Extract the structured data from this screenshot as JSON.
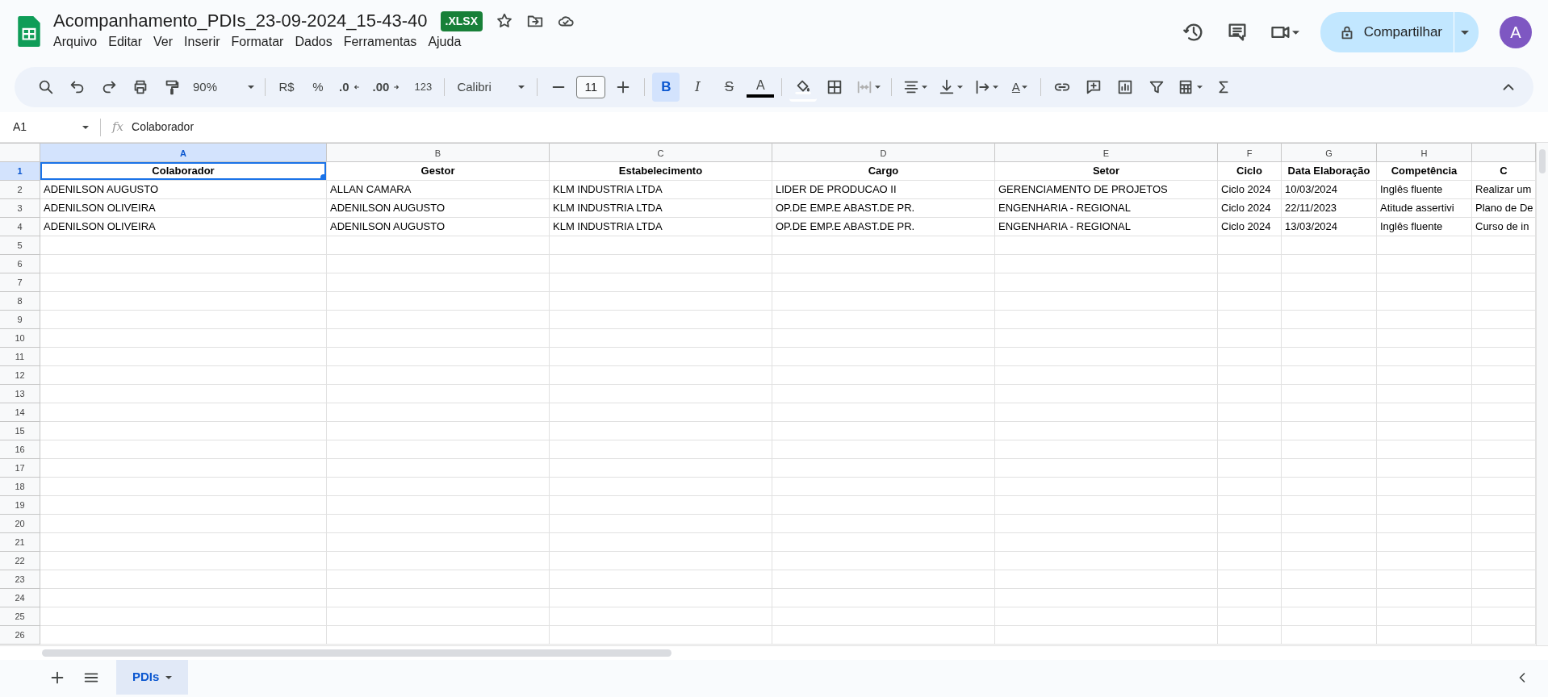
{
  "document": {
    "title": "Acompanhamento_PDIs_23-09-2024_15-43-40",
    "badge": ".XLSX"
  },
  "menu": [
    "Arquivo",
    "Editar",
    "Ver",
    "Inserir",
    "Formatar",
    "Dados",
    "Ferramentas",
    "Ajuda"
  ],
  "share_button": {
    "label": "Compartilhar"
  },
  "avatar": {
    "initial": "A"
  },
  "toolbar": {
    "zoom": "90%",
    "currency": "R$",
    "percent": "%",
    "decrease_decimal": ".0",
    "increase_decimal": ".00",
    "number_format": "123",
    "font": "Calibri",
    "font_size": "11",
    "bold": {
      "label": "B",
      "on": true
    },
    "italic": "I",
    "strikethrough": "S",
    "text_color": "A",
    "text_rotation": "A"
  },
  "formula_bar": {
    "cell": "A1",
    "fx": "fx",
    "value": "Colaborador"
  },
  "sheet": {
    "columns": [
      {
        "letter": "A",
        "selected": true
      },
      {
        "letter": "B",
        "selected": false
      },
      {
        "letter": "C",
        "selected": false
      },
      {
        "letter": "D",
        "selected": false
      },
      {
        "letter": "E",
        "selected": false
      },
      {
        "letter": "F",
        "selected": false
      },
      {
        "letter": "G",
        "selected": false
      },
      {
        "letter": "H",
        "selected": false
      },
      {
        "selected": false
      }
    ],
    "rows": [
      {
        "number": "1",
        "selected": true,
        "kind": "header",
        "cells": [
          "Colaborador",
          "Gestor",
          "Estabelecimento",
          "Cargo",
          "Setor",
          "Ciclo",
          "Data Elaboração",
          "Competência",
          "C"
        ]
      },
      {
        "number": "2",
        "selected": false,
        "kind": "data",
        "cells": [
          "ADENILSON AUGUSTO",
          "ALLAN CAMARA",
          "KLM INDUSTRIA LTDA",
          "LIDER DE PRODUCAO II",
          "GERENCIAMENTO DE PROJETOS",
          "Ciclo 2024",
          "10/03/2024",
          "Inglês fluente",
          "Realizar um"
        ]
      },
      {
        "number": "3",
        "selected": false,
        "kind": "data",
        "cells": [
          "ADENILSON OLIVEIRA",
          "ADENILSON AUGUSTO",
          "KLM INDUSTRIA LTDA",
          "OP.DE EMP.E ABAST.DE PR.",
          "ENGENHARIA - REGIONAL",
          "Ciclo 2024",
          "22/11/2023",
          "Atitude assertivi",
          "Plano de De"
        ]
      },
      {
        "number": "4",
        "selected": false,
        "kind": "data",
        "cells": [
          "ADENILSON OLIVEIRA",
          "ADENILSON AUGUSTO",
          "KLM INDUSTRIA LTDA",
          "OP.DE EMP.E ABAST.DE PR.",
          "ENGENHARIA - REGIONAL",
          "Ciclo 2024",
          "13/03/2024",
          "Inglês fluente",
          "Curso de in"
        ]
      },
      {
        "number": "5",
        "selected": false,
        "kind": "data"
      },
      {
        "number": "6",
        "selected": false,
        "kind": "data"
      },
      {
        "number": "7",
        "selected": false,
        "kind": "data"
      },
      {
        "number": "8",
        "selected": false,
        "kind": "data"
      },
      {
        "number": "9",
        "selected": false,
        "kind": "data"
      },
      {
        "number": "10",
        "selected": false,
        "kind": "data"
      },
      {
        "number": "11",
        "selected": false,
        "kind": "data"
      },
      {
        "number": "12",
        "selected": false,
        "kind": "data"
      },
      {
        "number": "13",
        "selected": false,
        "kind": "data"
      },
      {
        "number": "14",
        "selected": false,
        "kind": "data"
      },
      {
        "number": "15",
        "selected": false,
        "kind": "data"
      },
      {
        "number": "16",
        "selected": false,
        "kind": "data"
      },
      {
        "number": "17",
        "selected": false,
        "kind": "data"
      },
      {
        "number": "18",
        "selected": false,
        "kind": "data"
      },
      {
        "number": "19",
        "selected": false,
        "kind": "data"
      },
      {
        "number": "20",
        "selected": false,
        "kind": "data"
      },
      {
        "number": "21",
        "selected": false,
        "kind": "data"
      },
      {
        "number": "22",
        "selected": false,
        "kind": "data"
      },
      {
        "number": "23",
        "selected": false,
        "kind": "data"
      },
      {
        "number": "24",
        "selected": false,
        "kind": "data"
      },
      {
        "number": "25",
        "selected": false,
        "kind": "data"
      },
      {
        "number": "26",
        "selected": false,
        "kind": "data"
      }
    ]
  },
  "sheet_tabs": [
    {
      "label": "PDIs",
      "selected": true
    }
  ]
}
